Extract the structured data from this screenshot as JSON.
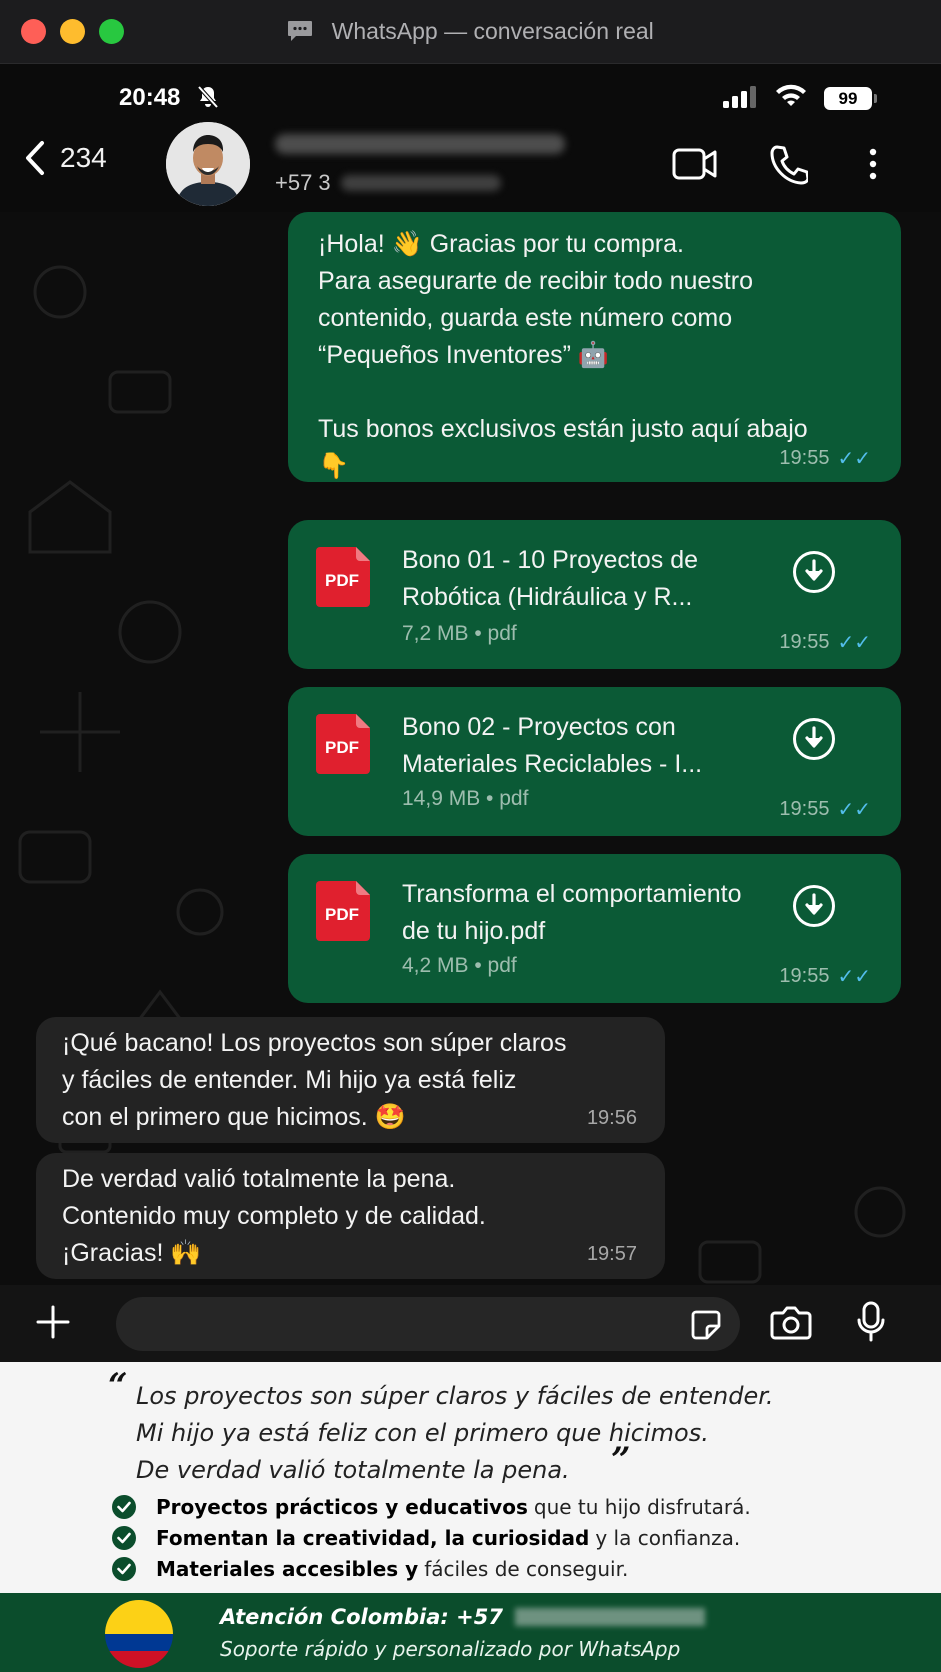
{
  "window": {
    "title": "WhatsApp — conversación real"
  },
  "status_bar": {
    "time": "20:48",
    "battery": "99"
  },
  "chat_header": {
    "back_count": "234",
    "phone_prefix": "+57 3"
  },
  "messages": [
    {
      "type": "text",
      "direction": "outgoing",
      "text": "¡Hola! 👋 Gracias por tu compra.\nPara asegurarte de recibir todo nuestro\ncontenido, guarda este número como\n“Pequeños Inventores” 🤖\n\nTus bonos exclusivos están justo aquí abajo\n👇",
      "time": "19:55",
      "ticks": "✓✓"
    },
    {
      "type": "document",
      "direction": "outgoing",
      "icon": "PDF",
      "name": "Bono 01 - 10 Proyectos de\nRobótica (Hidráulica y R...",
      "meta": "7,2 MB • pdf",
      "time": "19:55",
      "ticks": "✓✓"
    },
    {
      "type": "document",
      "direction": "outgoing",
      "icon": "PDF",
      "name": "Bono 02 - Proyectos con\nMateriales Reciclables - I...",
      "meta": "14,9 MB • pdf",
      "time": "19:55",
      "ticks": "✓✓"
    },
    {
      "type": "document",
      "direction": "outgoing",
      "icon": "PDF",
      "name": "Transforma el comportamiento\nde tu hijo.pdf",
      "meta": "4,2 MB • pdf",
      "time": "19:55",
      "ticks": "✓✓"
    },
    {
      "type": "text",
      "direction": "incoming",
      "text": "¡Qué bacano! Los proyectos son súper claros\ny fáciles de entender. Mi hijo ya está feliz\ncon el primero que hicimos. 🤩",
      "time": "19:56"
    },
    {
      "type": "text",
      "direction": "incoming",
      "text": "De verdad valió totalmente la pena.\nContenido muy completo y de calidad.\n¡Gracias! 🙌",
      "time": "19:57"
    }
  ],
  "testimonial": {
    "open_quote": "“",
    "close_quote": "”",
    "quote": "Los proyectos son súper claros y fáciles de entender.\nMi hijo ya está feliz con el primero que hicimos.\nDe verdad valió totalmente la pena.",
    "bullets": [
      {
        "bold": "Proyectos prácticos y educativos",
        "rest": "que tu hijo disfrutará."
      },
      {
        "bold": "Fomentan la creatividad, la curiosidad",
        "rest": "y la confianza."
      },
      {
        "bold": "Materiales accesibles y",
        "rest": "fáciles de conseguir."
      }
    ]
  },
  "footer": {
    "title": "Atención Colombia: +57",
    "subtitle": "Soporte rápido y personalizado por WhatsApp"
  },
  "colors": {
    "outgoing_bubble": "#0b5a36",
    "incoming_bubble": "#232323",
    "read_ticks": "#53bdeb",
    "footer_bg": "#0b4d2c",
    "pdf_red": "#e0202e"
  },
  "icons": [
    "chat-bubble-icon",
    "bell-off-icon",
    "signal-icon",
    "wifi-icon",
    "back-chevron-icon",
    "video-call-icon",
    "phone-icon",
    "more-icon",
    "pdf-icon",
    "download-icon",
    "plus-icon",
    "sticker-icon",
    "camera-icon",
    "mic-icon",
    "check-icon",
    "colombia-flag-icon"
  ]
}
